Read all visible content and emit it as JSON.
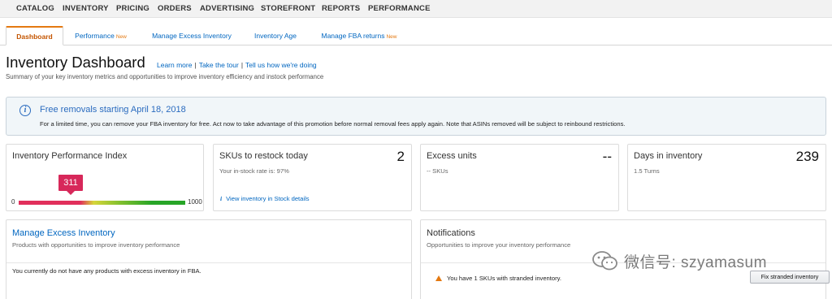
{
  "top_nav": {
    "items": [
      "CATALOG",
      "INVENTORY",
      "PRICING",
      "ORDERS",
      "ADVERTISING",
      "STOREFRONT",
      "REPORTS",
      "PERFORMANCE"
    ]
  },
  "tabs": [
    {
      "label": "Dashboard",
      "new": ""
    },
    {
      "label": "Performance",
      "new": "New"
    },
    {
      "label": "Manage Excess Inventory",
      "new": ""
    },
    {
      "label": "Inventory Age",
      "new": ""
    },
    {
      "label": "Manage FBA returns",
      "new": "New"
    }
  ],
  "header": {
    "title": "Inventory Dashboard",
    "links": [
      "Learn more",
      "Take the tour",
      "Tell us how we're doing"
    ],
    "subtitle": "Summary of your key inventory metrics and opportunities to improve inventory efficiency and instock performance"
  },
  "alert": {
    "icon": "info-icon",
    "title": "Free removals starting April 18, 2018",
    "body": "For a limited time, you can remove your FBA inventory for free. Act now to take advantage of this promotion before normal removal fees apply again. Note that ASINs removed will be subject to reinbound restrictions."
  },
  "ipi": {
    "title": "Inventory Performance Index",
    "score": "311",
    "score_fraction": 0.311,
    "min": "0",
    "max": "1000"
  },
  "restock": {
    "title": "SKUs to restock today",
    "value": "2",
    "sub": "Your in-stock rate is: 97%",
    "link": "View inventory in Stock details"
  },
  "excess": {
    "title": "Excess units",
    "value": "--",
    "sub": "-- SKUs"
  },
  "days": {
    "title": "Days in inventory",
    "value": "239",
    "sub": "1.5 Turns"
  },
  "manage_excess": {
    "title": "Manage Excess Inventory",
    "sub": "Products with opportunities to improve inventory performance",
    "body": "You currently do not have any products with excess inventory in FBA."
  },
  "notifications": {
    "title": "Notifications",
    "sub": "Opportunities to improve your inventory performance",
    "warning": "You have 1 SKUs with stranded inventory.",
    "button": "Fix stranded inventory"
  },
  "watermark": {
    "text": "微信号: szyamasum"
  },
  "colors": {
    "link": "#0066c0",
    "accent_orange": "#e47911",
    "ipi_marker": "#d7285a"
  }
}
